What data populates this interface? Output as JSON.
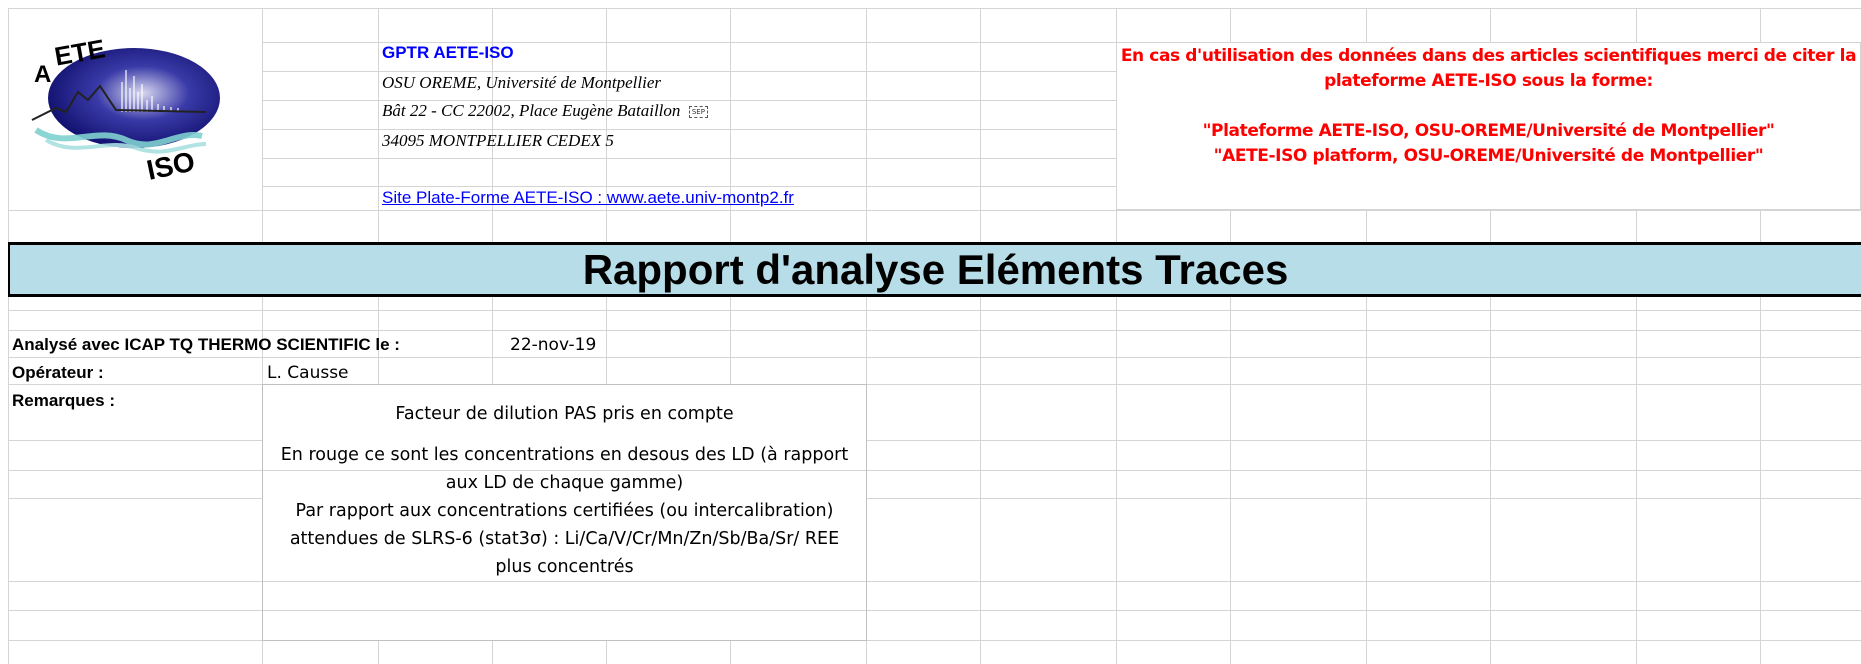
{
  "header": {
    "org": "GPTR  AETE-ISO",
    "lines": [
      "OSU OREME, Université de Montpellier",
      "Bât 22 - CC 22002, Place Eugène Bataillon",
      "34095 MONTPELLIER CEDEX 5"
    ],
    "sep_glyph": "SEP",
    "link": "Site Plate-Forme AETE-ISO : www.aete.univ-montp2.fr"
  },
  "logo": {
    "text_top": "ETE",
    "letter_a": "A",
    "text_bottom": "ISO"
  },
  "citation": {
    "line1": "En cas d'utilisation des données dans des articles scientifiques merci de citer la",
    "line2": "plateforme AETE-ISO sous la forme:",
    "line3": "\"Plateforme AETE-ISO, OSU-OREME/Université de Montpellier\"",
    "line4": "\"AETE-ISO platform, OSU-OREME/Université de Montpellier\""
  },
  "title": "Rapport d'analyse Eléments Traces",
  "analysis": {
    "label": "Analysé avec ICAP TQ  THERMO SCIENTIFIC le :",
    "date": "22-nov-19"
  },
  "operator": {
    "label": "Opérateur :",
    "value": "L. Causse"
  },
  "remarks": {
    "label": "Remarques :",
    "r1": "Facteur de dilution PAS pris en compte",
    "r2a": "En rouge ce sont les concentrations en desous des LD (à rapport",
    "r2b": "aux LD de chaque gamme)",
    "r3a": "Par rapport aux concentrations certifiées (ou intercalibration)",
    "r3b": "attendues de SLRS-6 (stat3σ) : Li/Ca/V/Cr/Mn/Zn/Sb/Ba/Sr/ REE",
    "r3c": "plus concentrés"
  },
  "colors": {
    "title_band": "#b7dde8",
    "link_blue": "#0000ff",
    "citation_red": "#ff0000",
    "grid": "#d4d4d4"
  }
}
